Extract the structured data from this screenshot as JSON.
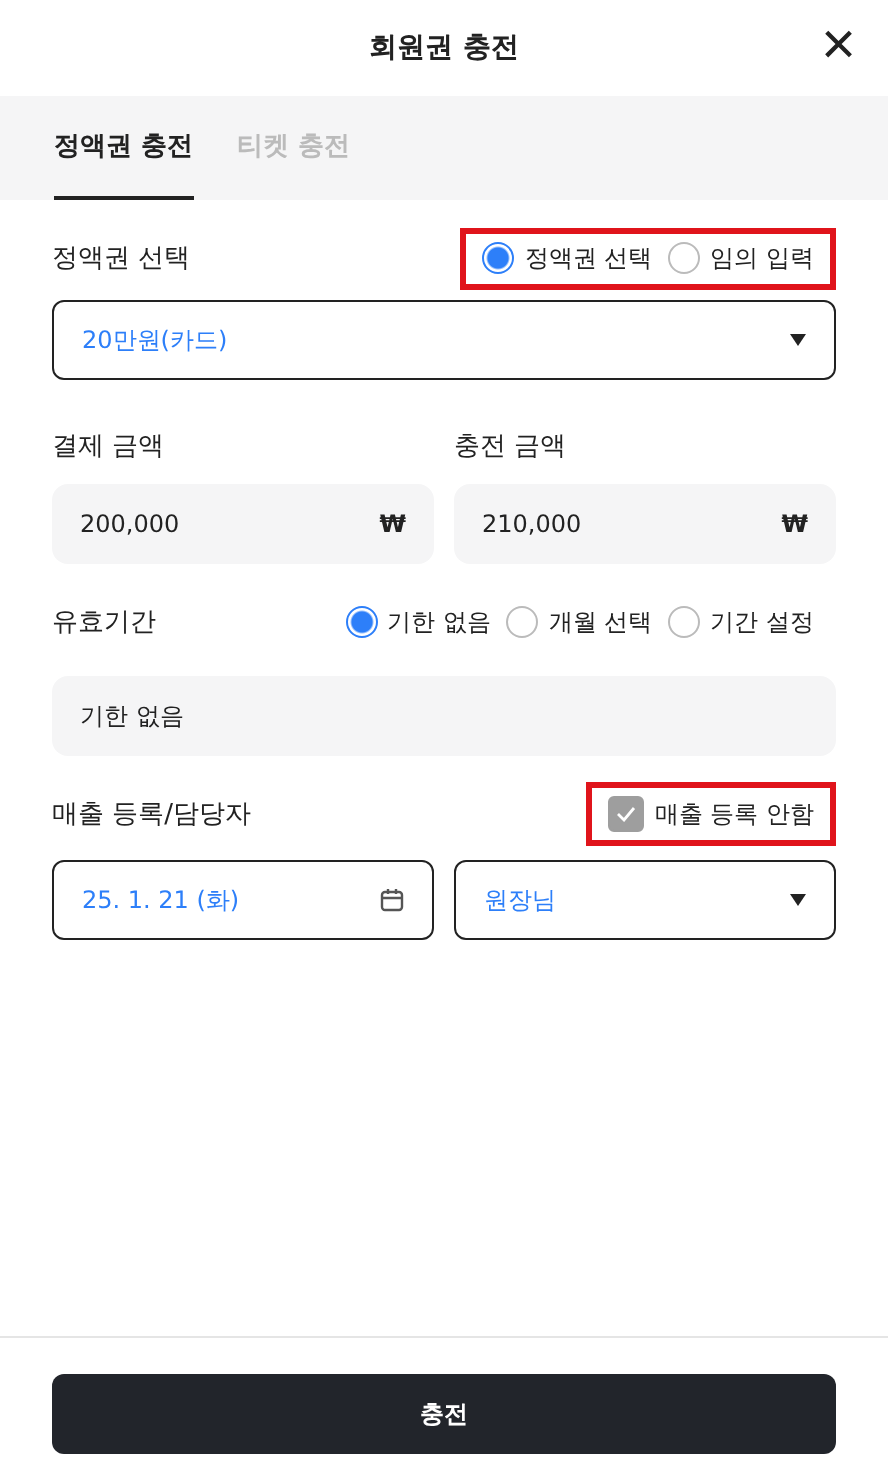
{
  "header": {
    "title": "회원권 충전",
    "close": "×"
  },
  "tabs": [
    {
      "label": "정액권 충전",
      "selected": true
    },
    {
      "label": "티켓 충전",
      "selected": false
    }
  ],
  "amount_select": {
    "label": "정액권 선택",
    "highlighted": true,
    "options": [
      {
        "label": "정액권 선택",
        "selected": true
      },
      {
        "label": "임의 입력",
        "selected": false
      }
    ],
    "value": "20만원(카드)"
  },
  "amounts": [
    {
      "label": "결제 금액",
      "value": "200,000",
      "unit": "₩"
    },
    {
      "label": "충전 금액",
      "value": "210,000",
      "unit": "₩"
    }
  ],
  "validity": {
    "label": "유효기간",
    "options": [
      {
        "label": "기한 없음",
        "selected": true
      },
      {
        "label": "개월 선택",
        "selected": false
      },
      {
        "label": "기간 설정",
        "selected": false
      }
    ],
    "value": "기한 없음"
  },
  "sales": {
    "label": "매출 등록/담당자",
    "highlighted": true,
    "checkbox": {
      "label": "매출 등록 안함",
      "checked": true
    },
    "date": "25. 1. 21 (화)",
    "staff": "원장님"
  },
  "submit": "충전"
}
